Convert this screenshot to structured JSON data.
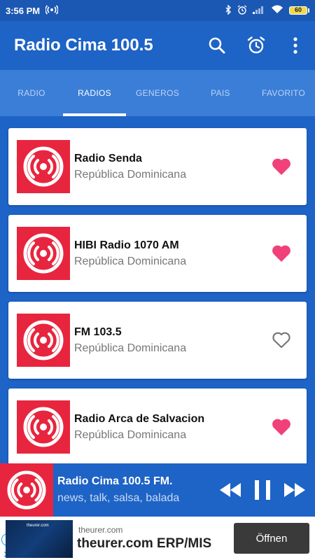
{
  "status_bar": {
    "time": "3:56 PM",
    "battery": "60"
  },
  "app_bar": {
    "title": "Radio Cima 100.5"
  },
  "tabs": [
    {
      "label": "RADIO",
      "active": false
    },
    {
      "label": "RADIOS",
      "active": true
    },
    {
      "label": "GENEROS",
      "active": false
    },
    {
      "label": "PAIS",
      "active": false
    },
    {
      "label": "FAVORITO",
      "active": false
    }
  ],
  "stations": [
    {
      "name": "Radio Senda",
      "country": "República Dominicana",
      "favorite": true
    },
    {
      "name": "HIBI Radio 1070 AM",
      "country": "República Dominicana",
      "favorite": true
    },
    {
      "name": "FM 103.5",
      "country": "República Dominicana",
      "favorite": false
    },
    {
      "name": "Radio Arca de Salvacion",
      "country": "República Dominicana",
      "favorite": true
    }
  ],
  "player": {
    "name": "Radio Cima 100.5 FM.",
    "description": "news, talk, salsa, balada"
  },
  "ad": {
    "domain": "theurer.com",
    "headline": "theurer.com ERP/MIS",
    "cta": "Öffnen",
    "thumb_text": "theurer.com"
  },
  "colors": {
    "primary": "#1e63c6",
    "tab_bar": "#3b7ed7",
    "logo_red": "#e8253e",
    "heart_pink": "#f0417a"
  },
  "icons": {
    "status": [
      "broadcast-icon",
      "bluetooth-icon",
      "alarm-icon",
      "signal-icon",
      "wifi-icon",
      "battery-icon"
    ],
    "toolbar": [
      "search-icon",
      "alarm-clock-icon",
      "more-vert-icon"
    ],
    "player": [
      "rewind-icon",
      "pause-icon",
      "fast-forward-icon"
    ]
  }
}
